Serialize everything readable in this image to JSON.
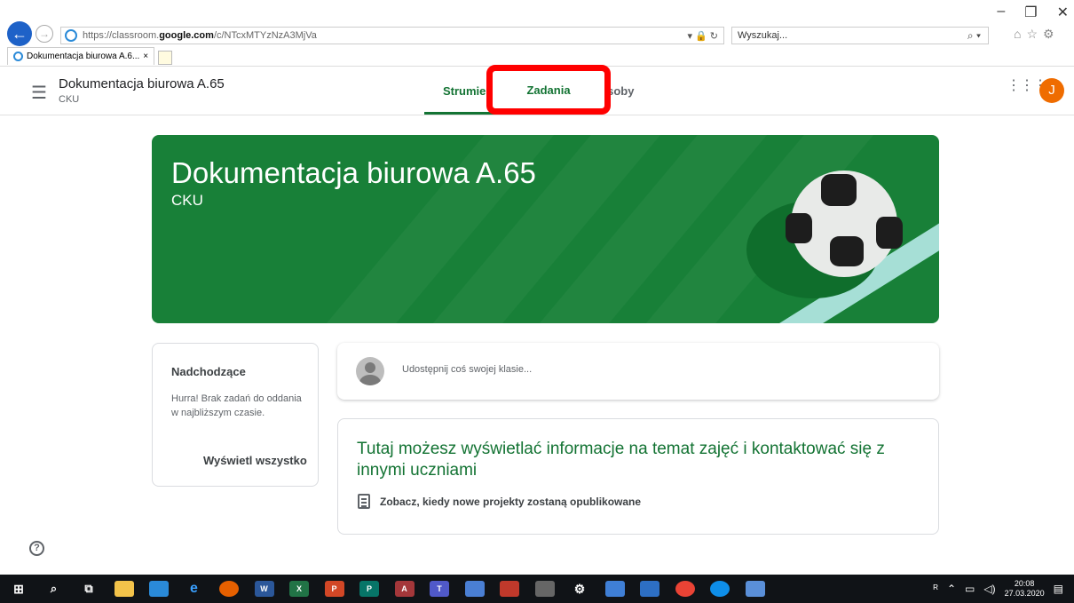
{
  "browser": {
    "url_prefix": "https://classroom.",
    "url_domain": "google.com",
    "url_path": "/c/NTcxMTYzNzA3MjVa",
    "search_placeholder": "Wyszukaj...",
    "tab_title": "Dokumentacja biurowa A.6...",
    "tab_close": "×"
  },
  "header": {
    "course_title": "Dokumentacja biurowa A.65",
    "course_subtitle": "CKU",
    "tab_stream": "Strumień",
    "tab_classwork": "Zadania",
    "tab_people": "Osoby",
    "avatar_letter": "J"
  },
  "banner": {
    "title": "Dokumentacja biurowa A.65",
    "subtitle": "CKU"
  },
  "upcoming": {
    "title": "Nadchodzące",
    "text": "Hurra! Brak zadań do oddania w najbliższym czasie.",
    "link": "Wyświetl wszystko"
  },
  "share": {
    "placeholder": "Udostępnij coś swojej klasie..."
  },
  "info": {
    "title": "Tutaj możesz wyświetlać informacje na temat zajęć i kontaktować się z innymi uczniami",
    "subtitle": "Zobacz, kiedy nowe projekty zostaną opublikowane"
  },
  "taskbar": {
    "time": "20:08",
    "date": "27.03.2020"
  },
  "colors": {
    "accent": "#137333",
    "banner": "#188038",
    "highlight": "#ff0000",
    "avatar": "#ef6c00"
  }
}
